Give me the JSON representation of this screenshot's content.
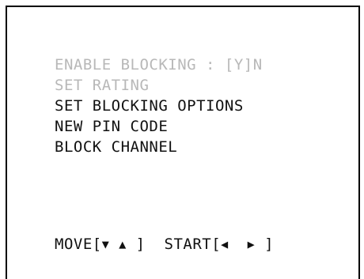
{
  "menu": {
    "items": [
      {
        "label": "ENABLE BLOCKING : [Y]N",
        "state": "disabled"
      },
      {
        "label": "SET RATING",
        "state": "disabled"
      },
      {
        "label": "SET BLOCKING OPTIONS",
        "state": "enabled"
      },
      {
        "label": "NEW PIN CODE",
        "state": "enabled"
      },
      {
        "label": "BLOCK CHANNEL",
        "state": "enabled"
      }
    ]
  },
  "footer": {
    "move_label": "MOVE[",
    "move_down": "▼",
    "move_up": "▲",
    "move_close": "]",
    "start_label": "START[",
    "start_left": "◀",
    "start_right": "▶",
    "start_close": "]"
  },
  "colors": {
    "disabled_text": "#b8b8b8",
    "enabled_text": "#111111",
    "border": "#000000",
    "background": "#ffffff"
  }
}
